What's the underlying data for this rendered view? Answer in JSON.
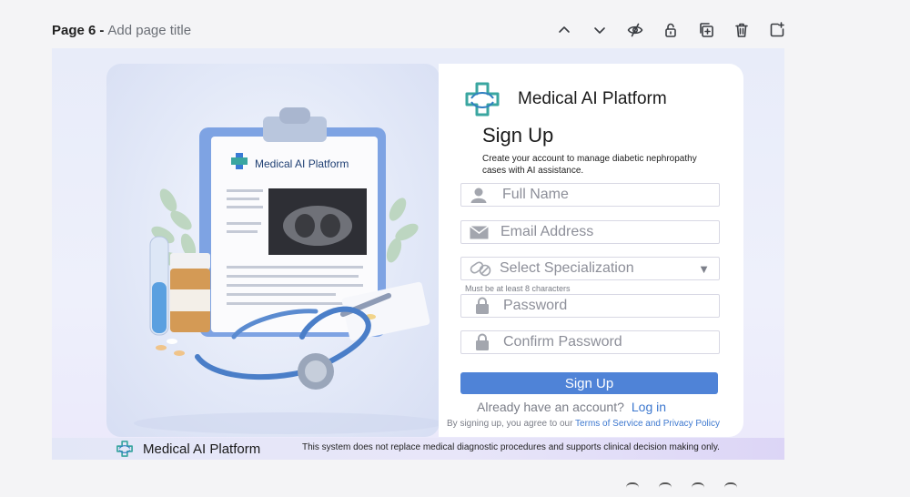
{
  "page_header": {
    "label": "Page 6",
    "separator": "-",
    "title_placeholder": "Add page title"
  },
  "toolbar": {
    "items": [
      {
        "icon": "chevron-up-icon"
      },
      {
        "icon": "chevron-down-icon"
      },
      {
        "icon": "eye-hide-icon"
      },
      {
        "icon": "lock-icon"
      },
      {
        "icon": "duplicate-page-icon"
      },
      {
        "icon": "trash-icon"
      },
      {
        "icon": "add-page-icon"
      }
    ]
  },
  "illustration": {
    "clipboard_brand": "Medical AI Platform"
  },
  "card": {
    "brand_name": "Medical AI Platform",
    "title": "Sign Up",
    "description": "Create your account to manage diabetic nephropathy cases with AI assistance.",
    "fields": {
      "full_name": {
        "placeholder": "Full Name",
        "icon": "user-icon"
      },
      "email": {
        "placeholder": "Email Address",
        "icon": "mail-icon"
      },
      "specialization": {
        "placeholder": "Select Specialization",
        "icon": "pills-icon",
        "caret": "▼"
      },
      "password_hint": "Must be at least 8 characters",
      "password": {
        "placeholder": "Password",
        "icon": "lock-icon"
      },
      "confirm_password": {
        "placeholder": "Confirm Password",
        "icon": "lock-icon"
      }
    },
    "signup_button": "Sign Up",
    "login_prompt": "Already have an account?",
    "login_link": "Log in",
    "terms_prefix": "By signing up, you agree to our",
    "terms_link": "Terms of Service and Privacy Policy"
  },
  "footer": {
    "brand_name": "Medical AI Platform",
    "disclaimer": "This system does not replace medical diagnostic procedures and supports clinical decision making only."
  },
  "colors": {
    "accent": "#4f83d7",
    "link": "#3d78cf",
    "logo_teal": "#3aa6a0"
  }
}
